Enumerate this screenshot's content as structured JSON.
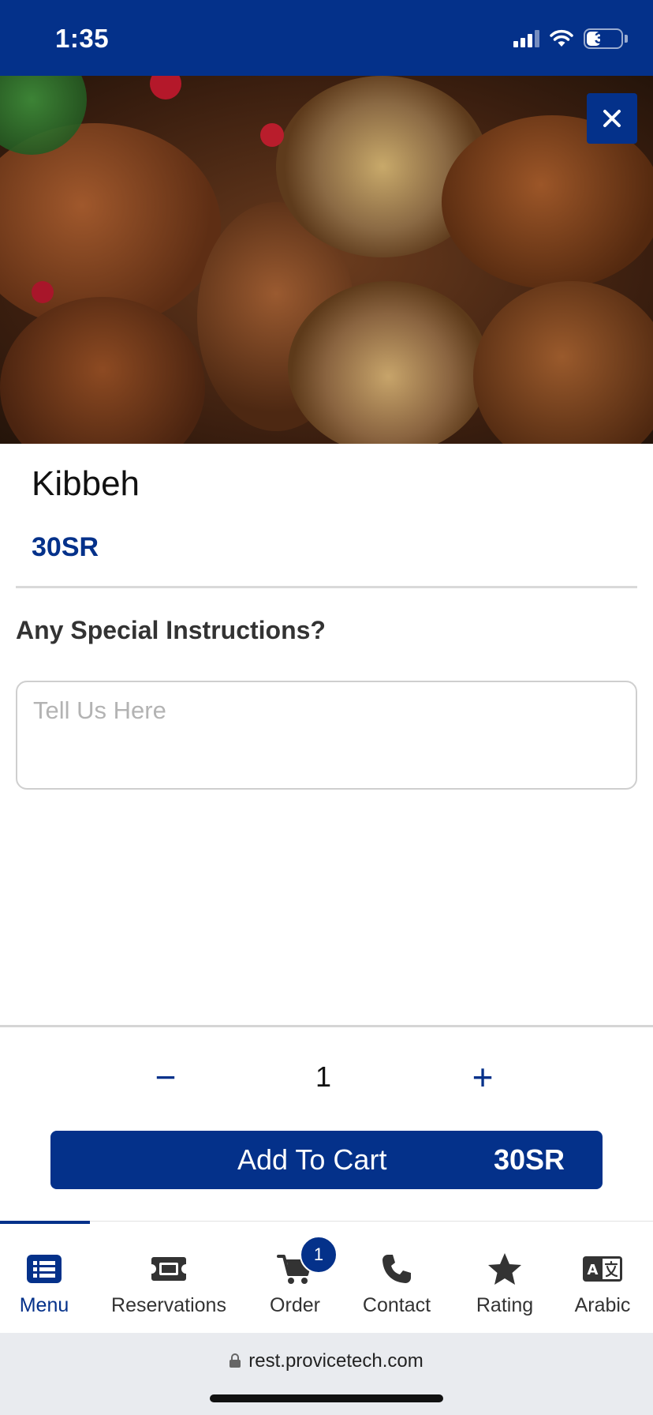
{
  "status_bar": {
    "time": "1:35",
    "battery": "38"
  },
  "product": {
    "name": "Kibbeh",
    "price": "30SR"
  },
  "instructions": {
    "label": "Any Special Instructions?",
    "placeholder": "Tell Us Here"
  },
  "quantity": {
    "minus": "−",
    "value": "1",
    "plus": "+"
  },
  "add_to_cart": {
    "label": "Add To Cart",
    "price": "30SR"
  },
  "tabs": [
    {
      "label": "Menu",
      "icon": "list-icon",
      "active": true
    },
    {
      "label": "Reservations",
      "icon": "ticket-icon"
    },
    {
      "label": "Order",
      "icon": "cart-icon",
      "badge": "1"
    },
    {
      "label": "Contact",
      "icon": "phone-icon"
    },
    {
      "label": "Rating",
      "icon": "star-icon"
    },
    {
      "label": "Arabic",
      "icon": "translate-icon"
    }
  ],
  "browser": {
    "url": "rest.provicetech.com"
  },
  "colors": {
    "brand": "#04318a"
  }
}
